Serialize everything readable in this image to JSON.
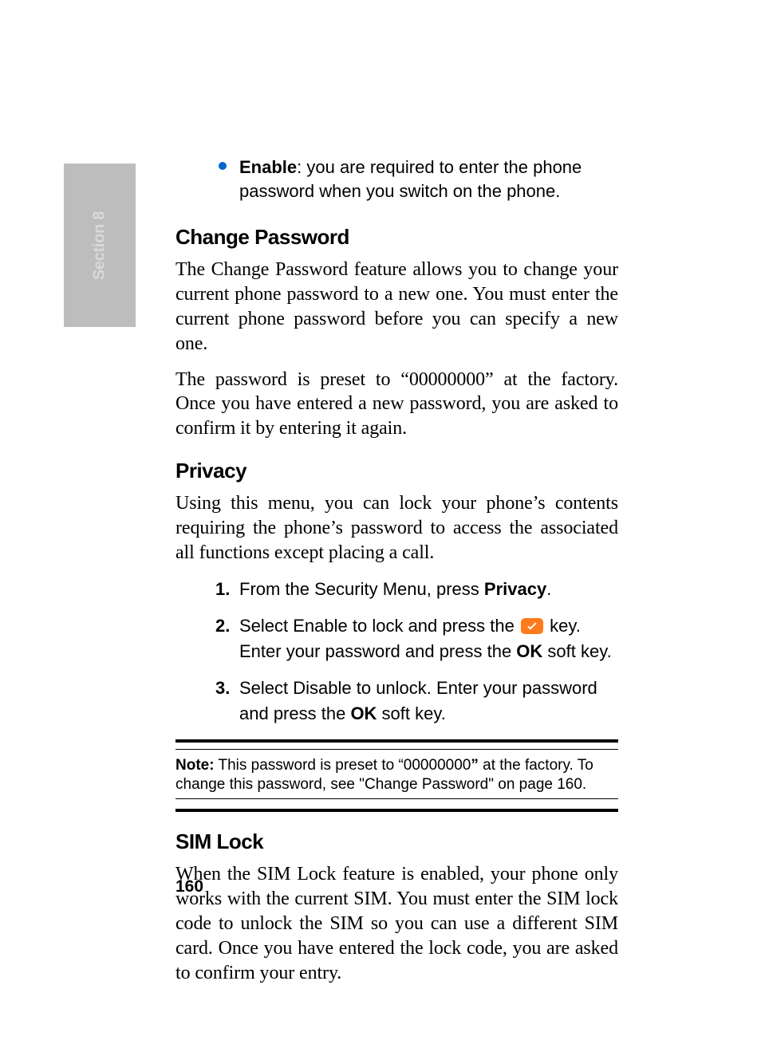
{
  "side_tab": "Section 8",
  "bullet": {
    "label": "Enable",
    "text": ": you are required to enter the phone password when you switch on the phone."
  },
  "change_password": {
    "heading": "Change Password",
    "p1": "The Change Password feature allows you to change your current phone password to a new one. You must enter the current phone password before you can specify a new one.",
    "p2": "The password is preset to “00000000” at the factory. Once you have entered a new password, you are asked to confirm it by entering it again."
  },
  "privacy": {
    "heading": "Privacy",
    "intro": "Using this menu, you can lock your phone’s contents requiring the phone’s password to access the associated all functions except placing a call.",
    "steps": {
      "s1": {
        "num": "1.",
        "pre": "From the Security Menu, press ",
        "bold": "Privacy",
        "post": "."
      },
      "s2": {
        "num": "2.",
        "pre": "Select Enable to lock and press the ",
        "mid": " key. Enter your password and press the ",
        "bold": "OK",
        "post": " soft key."
      },
      "s3": {
        "num": "3.",
        "pre": "Select Disable to unlock. Enter your password and press the ",
        "bold": "OK",
        "post": " soft key."
      }
    }
  },
  "note": {
    "label": "Note:",
    "t1": " This password is preset to “00000000",
    "bold_quote": "”",
    "t2": " at the factory. To change this password, see \"Change Password\" on page 160."
  },
  "sim_lock": {
    "heading": "SIM Lock",
    "p1": "When the SIM Lock feature is enabled, your phone only works with the current SIM. You must enter the SIM lock code to unlock the SIM so you can use a different SIM card. Once you have entered the lock code, you are asked to confirm your entry."
  },
  "page_number": "160"
}
